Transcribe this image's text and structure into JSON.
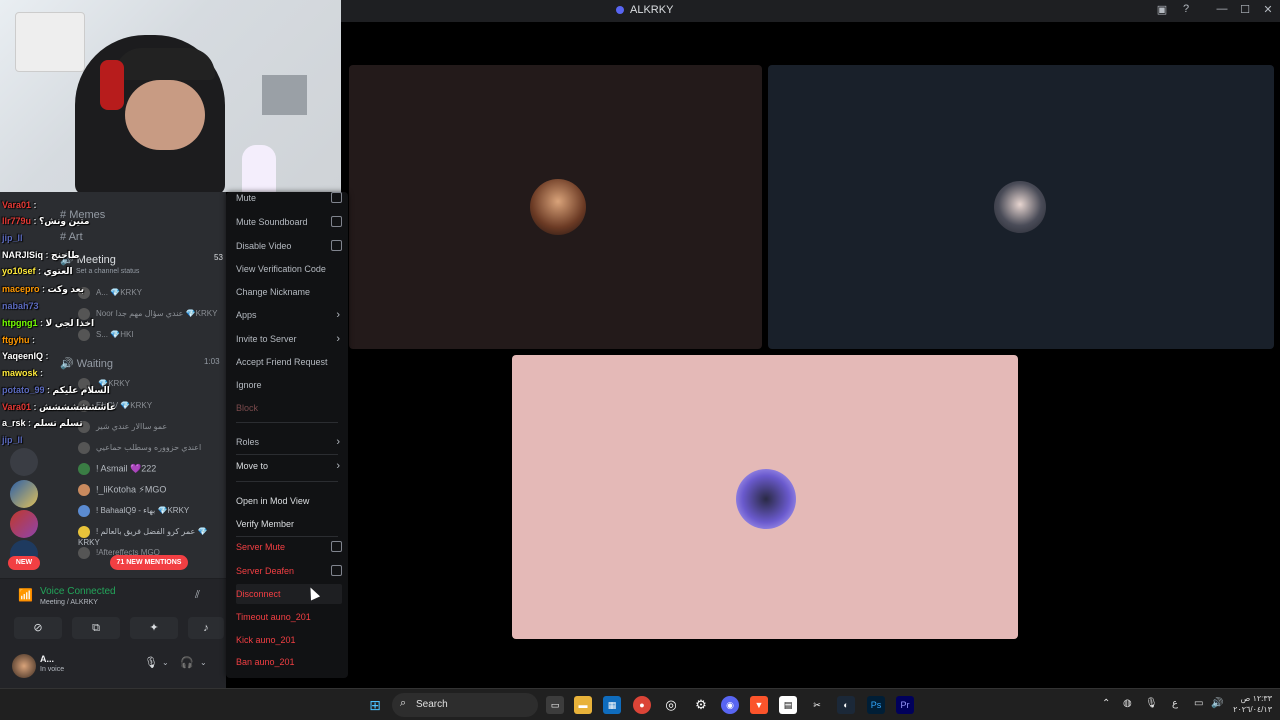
{
  "window": {
    "title": "ALKRKY",
    "controls": {
      "minimize": "—",
      "maximize": "☐",
      "close": "✕",
      "help": "?"
    }
  },
  "stream": {
    "tiles": [
      {
        "id": "top-left",
        "bg": "#231a1a"
      },
      {
        "id": "top-right",
        "bg": "#19202a"
      },
      {
        "id": "bottom",
        "bg": "#e4b9b7"
      }
    ]
  },
  "sidebar": {
    "channels": [
      {
        "icon": "#",
        "label": "Memes"
      },
      {
        "icon": "#",
        "label": "Art"
      },
      {
        "icon": "🔊",
        "label": "Meeting",
        "count": "53"
      },
      {
        "icon": "",
        "label": "Set a channel status"
      },
      {
        "icon": "🔊",
        "label": "Waiting",
        "count": "1:03"
      }
    ],
    "members": [
      {
        "name": "A...",
        "tag": "KRKY"
      },
      {
        "name": "Noor",
        "note": "عندي سؤال مهم جدا",
        "tag": "KRKY"
      },
      {
        "name": "S...",
        "tag": "HKI"
      },
      {
        "name": "",
        "tag": "KRKY"
      },
      {
        "name": "EHRV",
        "tag": "KRKY"
      },
      {
        "name": "عمو ساالار عندي شير",
        "tag": ""
      },
      {
        "name": "اعندي حزووره وسطلب حماعيي",
        "tag": ""
      },
      {
        "name": "! Asmail",
        "tag": "222"
      },
      {
        "name": "!_liKotoha",
        "tag": "MGO"
      },
      {
        "name": "! BahaalQ9 - بهاء",
        "tag": "KRKY"
      },
      {
        "name": "! عمر كرو الفضل فريق بالعالم",
        "tag": "KRKY"
      },
      {
        "name": "!Aftereffects",
        "tag": "MGO"
      }
    ],
    "new_badge": "NEW",
    "mentions_badge": "71 NEW MENTIONS"
  },
  "chat_overlay": [
    {
      "user": "Vara01",
      "msg": "",
      "color": "#e53935"
    },
    {
      "user": "llr779u",
      "msg": "متين ونش؟",
      "color": "#e53935"
    },
    {
      "user": "jip_ll",
      "msg": "",
      "color": "#3f51b5"
    },
    {
      "user": "NARJISiq",
      "msg": "طاحنج",
      "color": "#ffffff"
    },
    {
      "user": "yo10sef",
      "msg": "العتوي",
      "color": "#ffeb3b"
    },
    {
      "user": "macepro",
      "msg": "بعد وكت",
      "color": "#ff9800"
    },
    {
      "user": "nabah73",
      "msg": "",
      "color": "#3f51b5"
    },
    {
      "user": "htpgng1",
      "msg": "اخذا لجي لا",
      "color": "#76ff03"
    },
    {
      "user": "ftgyhu",
      "msg": "",
      "color": "#ff9800"
    },
    {
      "user": "YaqeenIQ",
      "msg": "",
      "color": "#ffffff"
    },
    {
      "user": "mawosk",
      "msg": "",
      "color": "#ffeb3b"
    },
    {
      "user": "potato_99",
      "msg": "السلام عليكم",
      "color": "#3f51b5"
    },
    {
      "user": "Vara01",
      "msg": "عاششششششش",
      "color": "#e53935"
    },
    {
      "user": "a_rsk",
      "msg": "تسلم تسلم",
      "color": "#ffffff"
    },
    {
      "user": "jip_ll",
      "msg": "",
      "color": "#3f51b5"
    }
  ],
  "voice": {
    "status": "Voice Connected",
    "location": "Meeting / ALKRKY",
    "user_name": "A...",
    "user_status": "In voice"
  },
  "context_menu": {
    "items": [
      {
        "label": "Mute",
        "type": "check",
        "style": "normal"
      },
      {
        "label": "Mute Soundboard",
        "type": "check",
        "style": "normal"
      },
      {
        "label": "Disable Video",
        "type": "check",
        "style": "normal"
      },
      {
        "label": "View Verification Code",
        "type": "plain",
        "style": "normal"
      },
      {
        "label": "Change Nickname",
        "type": "plain",
        "style": "normal"
      },
      {
        "label": "Apps",
        "type": "submenu",
        "style": "normal"
      },
      {
        "label": "Invite to Server",
        "type": "submenu",
        "style": "normal"
      },
      {
        "label": "Accept Friend Request",
        "type": "plain",
        "style": "normal"
      },
      {
        "label": "Ignore",
        "type": "plain",
        "style": "normal"
      },
      {
        "label": "Block",
        "type": "plain",
        "style": "faded"
      },
      {
        "label": "Roles",
        "type": "submenu",
        "style": "normal"
      },
      {
        "label": "Move to",
        "type": "submenu",
        "style": "bright"
      },
      {
        "label": "Open in Mod View",
        "type": "plain",
        "style": "bright"
      },
      {
        "label": "Verify Member",
        "type": "plain",
        "style": "bright"
      },
      {
        "label": "Server Mute",
        "type": "check",
        "style": "danger"
      },
      {
        "label": "Server Deafen",
        "type": "check",
        "style": "danger"
      },
      {
        "label": "Disconnect",
        "type": "plain",
        "style": "danger"
      },
      {
        "label": "Timeout auno_201",
        "type": "plain",
        "style": "danger"
      },
      {
        "label": "Kick auno_201",
        "type": "plain",
        "style": "danger"
      },
      {
        "label": "Ban auno_201",
        "type": "plain",
        "style": "danger"
      }
    ]
  },
  "taskbar": {
    "search_label": "Search",
    "clock_time": "١٢:٣٣ ص",
    "clock_date": "٢٠٢٦/٠٤/١٣",
    "lang": "ع"
  }
}
